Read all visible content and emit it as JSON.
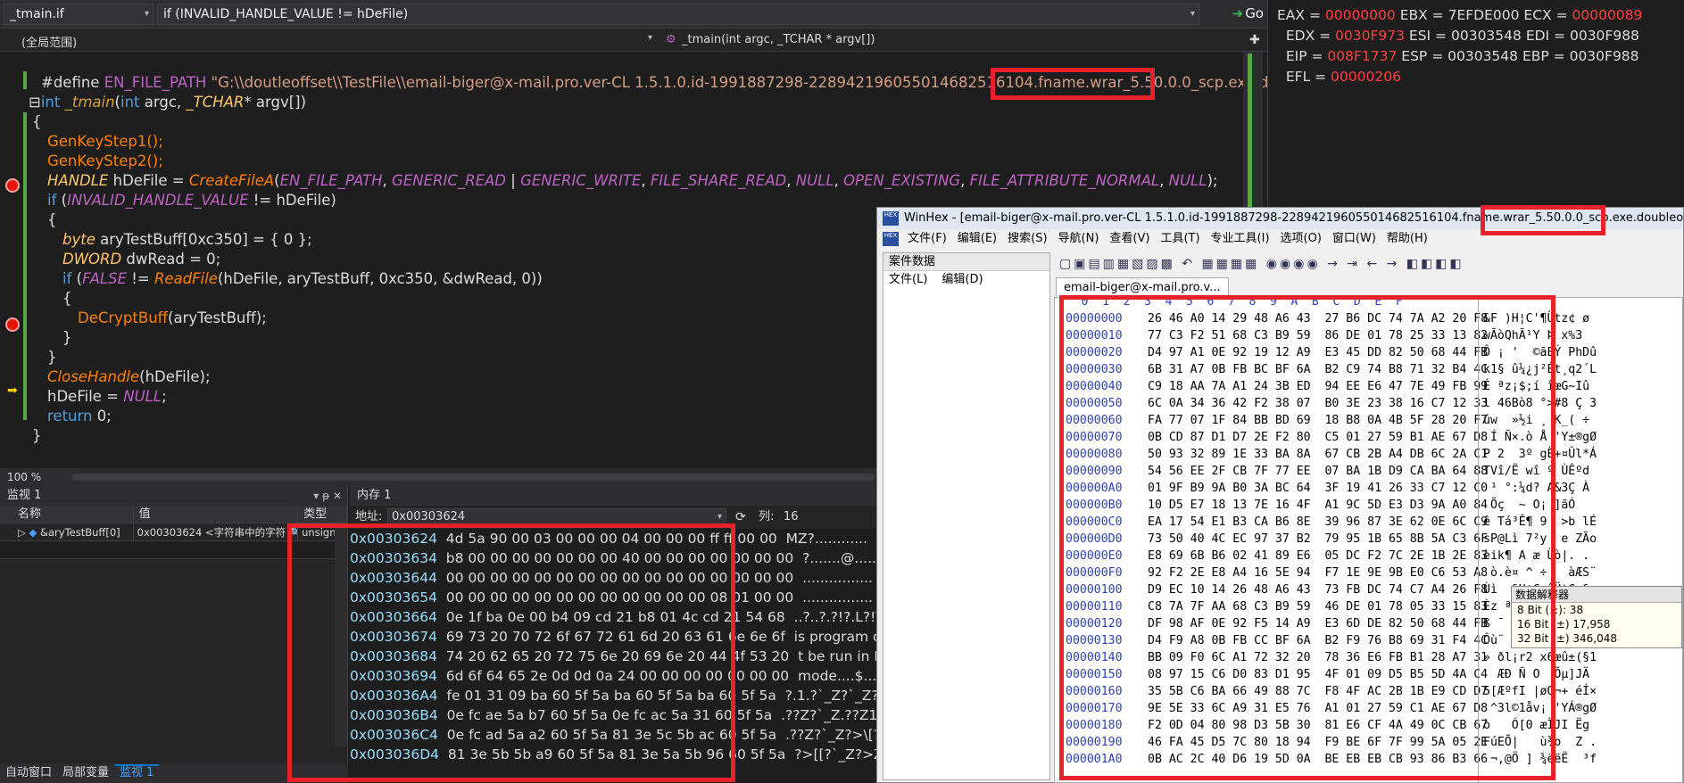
{
  "editor": {
    "file_combo": "_tmain.if",
    "context_combo": "if (INVALID_HANDLE_VALUE != hDeFile)",
    "go_label": "Go",
    "scope_combo": "(全局范围)",
    "function_combo": "_tmain(int argc, _TCHAR * argv[])",
    "zoom": "100 %",
    "lines": {
      "l1_kw": "#define",
      "l1_name": "EN_FILE_PATH",
      "l1_str": "\"G:\\\\doutleoffset\\\\TestFile\\\\email-biger@x-mail.pro.ver-CL 1.5.1.0.id-1991887298-228942196055014682516104.fname.wrar_5.50.0.0_scp.exe.doubleoffset\"",
      "l2_kw": "int",
      "l2_fn": "_tmain",
      "l2_rest_a": "(",
      "l2_kw2": "int",
      "l2_rest_b": " argc, ",
      "l2_type": "_TCHAR",
      "l2_rest_c": "* argv[])",
      "l3": "{",
      "l4": "GenKeyStep1();",
      "l5": "GenKeyStep2();",
      "l6_type": "HANDLE",
      "l6_a": " hDeFile = ",
      "l6_fn": "CreateFileA",
      "l6_b": "(",
      "l6_m1": "EN_FILE_PATH",
      "l6_c": ", ",
      "l6_m2": "GENERIC_READ",
      "l6_d": " | ",
      "l6_m3": "GENERIC_WRITE",
      "l6_e": ", ",
      "l6_m4": "FILE_SHARE_READ",
      "l6_f": ", ",
      "l6_m5": "NULL",
      "l6_g": ", ",
      "l6_m6": "OPEN_EXISTING",
      "l6_h": ", ",
      "l6_m7": "FILE_ATTRIBUTE_NORMAL",
      "l6_i": ", ",
      "l6_m8": "NULL",
      "l6_j": ");",
      "l7_kw": "if",
      "l7_a": " (",
      "l7_m": "INVALID_HANDLE_VALUE",
      "l7_b": " != hDeFile)",
      "l8": "{",
      "l9_kw": "byte",
      "l9_a": " aryTestBuff[0xc350] = { 0 };",
      "l10_type": "DWORD",
      "l10_a": " dwRead = 0;",
      "l11_kw": "if",
      "l11_a": " (",
      "l11_m": "FALSE",
      "l11_b": " != ",
      "l11_fn": "ReadFile",
      "l11_c": "(hDeFile, aryTestBuff, 0xc350, &dwRead, 0))",
      "l12": "{",
      "l13_fn": "DeCryptBuff",
      "l13_a": "(aryTestBuff);",
      "l14": "}",
      "l15": "}",
      "l16_fn": "CloseHandle",
      "l16_a": "(hDeFile);",
      "l17_a": "hDeFile = ",
      "l17_m": "NULL",
      "l17_b": ";",
      "l18_kw": "return",
      "l18_a": " 0;",
      "l19": "}"
    }
  },
  "registers": {
    "line1": [
      "EAX = ",
      "00000000",
      " EBX = ",
      "7EFDE000",
      " ECX = ",
      "00000089"
    ],
    "line2": [
      "  EDX = ",
      "0030F973",
      " ESI = ",
      "00303548",
      " EDI = ",
      "0030F988"
    ],
    "line3": [
      "  EIP = ",
      "008F1737",
      " ESP = ",
      "00303548",
      " EBP = ",
      "0030F988"
    ],
    "line4": [
      "  EFL = ",
      "00000206"
    ]
  },
  "watch": {
    "title": "监视 1",
    "pin_icons": "▾ ᵽ ✕",
    "col_name": "名称",
    "col_value": "值",
    "col_type": "类型",
    "row_name": "&aryTestBuff[0]",
    "row_value": "0x00303624 <字符串中的字符",
    "row_type": "unsigned",
    "tabs": [
      "自动窗口",
      "局部变量",
      "监视 1"
    ]
  },
  "memory": {
    "title": "内存 1",
    "addr_label": "地址:",
    "addr_value": "0x00303624",
    "col_label": "列:",
    "col_value": "16",
    "rows": [
      {
        "addr": "0x00303624",
        "hex": "4d 5a 90 00 03 00 00 00 04 00 00 00 ff ff 00 00",
        "ascii": "MZ?............"
      },
      {
        "addr": "0x00303634",
        "hex": "b8 00 00 00 00 00 00 00 40 00 00 00 00 00 00 00",
        "ascii": "?.......@......."
      },
      {
        "addr": "0x00303644",
        "hex": "00 00 00 00 00 00 00 00 00 00 00 00 00 00 00 00",
        "ascii": "................"
      },
      {
        "addr": "0x00303654",
        "hex": "00 00 00 00 00 00 00 00 00 00 00 00 08 01 00 00",
        "ascii": "................"
      },
      {
        "addr": "0x00303664",
        "hex": "0e 1f ba 0e 00 b4 09 cd 21 b8 01 4c cd 21 54 68",
        "ascii": "..?..?.?!?.L?!Th"
      },
      {
        "addr": "0x00303674",
        "hex": "69 73 20 70 72 6f 67 72 61 6d 20 63 61 6e 6e 6f",
        "ascii": "is program canno"
      },
      {
        "addr": "0x00303684",
        "hex": "74 20 62 65 20 72 75 6e 20 69 6e 20 44 4f 53 20",
        "ascii": "t be run in DOS "
      },
      {
        "addr": "0x00303694",
        "hex": "6d 6f 64 65 2e 0d 0d 0a 24 00 00 00 00 00 00 00",
        "ascii": "mode....$......."
      },
      {
        "addr": "0x003036A4",
        "hex": "fe 01 31 09 ba 60 5f 5a ba 60 5f 5a ba 60 5f 5a",
        "ascii": "?.1.?`_Z?`_Z?`_Z"
      },
      {
        "addr": "0x003036B4",
        "hex": "0e fc ae 5a b7 60 5f 5a 0e fc ac 5a 31 60 5f 5a",
        "ascii": ".??Z?`_Z.??Z1`_Z"
      },
      {
        "addr": "0x003036C4",
        "hex": "0e fc ad 5a a2 60 5f 5a 81 3e 5c 5b ac 60 5f 5a",
        "ascii": ".??Z?`_Z?>\\[?`_Z"
      },
      {
        "addr": "0x003036D4",
        "hex": "81 3e 5b 5b a9 60 5f 5a 81 3e 5a 5b 96 60 5f 5a",
        "ascii": "?>[[?`_Z?>Z[?`_Z"
      }
    ]
  },
  "winhex": {
    "title": "WinHex - [email-biger@x-mail.pro.ver-CL 1.5.1.0.id-1991887298-228942196055014682516104.fname.wrar_5.50.0.0_scp.exe.doubleoffset]",
    "menu": [
      "文件(F)",
      "编辑(E)",
      "搜索(S)",
      "导航(N)",
      "查看(V)",
      "工具(T)",
      "专业工具(I)",
      "选项(O)",
      "窗口(W)",
      "帮助(H)"
    ],
    "left_title": "案件数据",
    "left_menu": [
      "文件(L)",
      "编辑(D)"
    ],
    "toolbar_glyphs": "▢▣▤▥▦▧▨▩ ↶ ▦▦▦▦ ◉◉◉◉ → ⇥ ← → ◧◧◧◧",
    "tab": "email-biger@x-mail.pro.v...",
    "ruler": "  0  1  2  3  4  5  6  7  8  9  A  B  C  D  E  F",
    "rows": [
      {
        "off": "00000000",
        "hex": "26 46 A0 14 29 48 A6 43  27 B6 DC 74 7A A2 20 F8",
        "asc": "&F )H¦C'¶Ütz¢ ø"
      },
      {
        "off": "00000010",
        "hex": "77 C3 F2 51 68 C3 B9 59  86 DE 01 78 25 33 13 82",
        "asc": "wÃòQhÃ¹Y Þ x%3 "
      },
      {
        "off": "00000020",
        "hex": "D4 97 A1 0E 92 19 12 A9  E3 45 DD 82 50 68 44 FB",
        "asc": "Ô ¡ '  ©ãEÝ PhDû"
      },
      {
        "off": "00000030",
        "hex": "6B 31 A7 0B FB BC BF 6A  B2 C9 74 B8 71 32 B4 4C",
        "asc": "k1§ û¼¿j²Ét¸q2´L"
      },
      {
        "off": "00000040",
        "hex": "C9 18 AA 7A A1 24 3B ED  94 EE E6 47 7E 49 FB 99",
        "asc": "É ªz¡$;í îæG~Iû "
      },
      {
        "off": "00000050",
        "hex": "6C 0A 34 36 42 F2 38 07  B0 3E 23 38 16 C7 12 33",
        "asc": "l 46Bò8 °>#8 Ç 3"
      },
      {
        "off": "00000060",
        "hex": "FA 77 07 1F 84 BB BD 69  18 B8 0A 4B 5F 28 20 F7",
        "asc": "úw  »½i ¸ K_( ÷"
      },
      {
        "off": "00000070",
        "hex": "0B CD 87 D1 D7 2E F2 80  C5 01 27 59 B1 AE 67 D8",
        "asc": " Í Ñ×.ò Å 'Y±®gØ"
      },
      {
        "off": "00000080",
        "hex": "50 93 32 89 1E 33 BA 8A  67 CB 2B A4 DB 6C 2A C1",
        "asc": "P 2  3º gË+¤Ûl*Á"
      },
      {
        "off": "00000090",
        "hex": "54 56 EE 2F CB 7F 77 EE  07 BA 1B D9 CA BA 64 88",
        "asc": "TVî/Ë wî º ÙÊºd "
      },
      {
        "off": "000000A0",
        "hex": "01 9F B9 9A B0 3A BC 64  3F 19 41 26 33 C7 12 C0",
        "asc": " ¹ °:¼d? A&3Ç À"
      },
      {
        "off": "000000B0",
        "hex": "10 D5 E7 18 13 7E 16 4F  A1 9C 5D E3 D3 9A A0 84",
        "asc": " Õç  ~ O¡ ]ãÓ  "
      },
      {
        "off": "000000C0",
        "hex": "EA 17 54 E1 B3 CA B6 8E  39 96 87 3E 62 0E 6C C9",
        "asc": "ê Tá³Ê¶ 9  >b lÉ"
      },
      {
        "off": "000000D0",
        "hex": "73 50 40 4C EC 97 37 B2  79 95 1B 65 8B 5A C3 6F",
        "asc": "sP@Lì 7²y  e ZÃo"
      },
      {
        "off": "000000E0",
        "hex": "E8 69 6B B6 02 41 89 E6  05 DC F2 7C 2E 1B 2E 83",
        "asc": "èik¶ A æ Üò|. . "
      },
      {
        "off": "000000F0",
        "hex": "92 F2 2E E8 A4 16 5E 94  F7 1E 9E 9B E0 C6 53 A8",
        "asc": " ò.è¤ ^ ÷   àÆS¨"
      },
      {
        "off": "00000100",
        "hex": "D9 EC 10 14 26 48 A6 43  73 FB DC 74 C7 A4 26 F8",
        "asc": "Ùì  &H¦CsûÜtÇ¤&ø"
      },
      {
        "off": "00000110",
        "hex": "C8 7A 7F AA 68 C3 B9 59  46 DE 01 78 05 33 15 83",
        "asc": "Èz ªhÃ¹YFÞ x 3  "
      },
      {
        "off": "00000120",
        "hex": "DF 98 AF 0E 92 F5 14 A9  E3 6D DE 82 50 68 44 FB",
        "asc": "ß ¯  õ ©ãmÞ PhDû"
      },
      {
        "off": "00000130",
        "hex": "D4 F9 A8 0B FB CC BF 6A  B2 F9 76 B8 69 31 F4 4C",
        "asc": "Ôù¨ ûÌ¿j²ùv¸i1ôL"
      },
      {
        "off": "00000140",
        "hex": "BB 09 F0 6C A1 72 32 20  78 36 E6 FB B1 28 A7 31",
        "asc": "» ðl¡r2 x6æû±(§1"
      },
      {
        "off": "00000150",
        "hex": "08 97 15 C6 D0 83 D1 95  4F 01 09 D5 B5 5D 4A C4",
        "asc": "  ÆÐ Ñ O  Õµ]JÄ"
      },
      {
        "off": "00000160",
        "hex": "35 5B C6 BA 66 49 88 7C  F8 4F AC 2B 1B E9 CD D7",
        "asc": "5[ÆºfI |øO¬+ éÍ×"
      },
      {
        "off": "00000170",
        "hex": "9E 5E 33 6C A9 31 E5 76  A1 01 27 59 C1 AE 67 D8",
        "asc": " ^3l©1åv¡ 'YÁ®gØ"
      },
      {
        "off": "00000180",
        "hex": "F2 0D 04 80 98 D3 5B 30  81 E6 CF 4A 49 0C CB 67",
        "asc": "ò   Ó[0 æÏJI Ëg"
      },
      {
        "off": "00000190",
        "hex": "46 FA 45 D5 7C 80 18 94  F9 BE 6F 7F 99 5A 05 2E",
        "asc": "FúEÕ|   ù¾o  Z ."
      },
      {
        "off": "000001A0",
        "hex": "0B AC 2C 40 D6 19 5D 0A  BE EB EB CB 93 86 B3 66",
        "asc": " ¬,@Ö ] ¾ëëË  ³f"
      }
    ],
    "interp": {
      "title": "数据解释器",
      "l8": "8 Bit (±): 38",
      "l16": "16 Bit (±) 17,958",
      "l32": "32 Bit (±) 346,048"
    }
  }
}
